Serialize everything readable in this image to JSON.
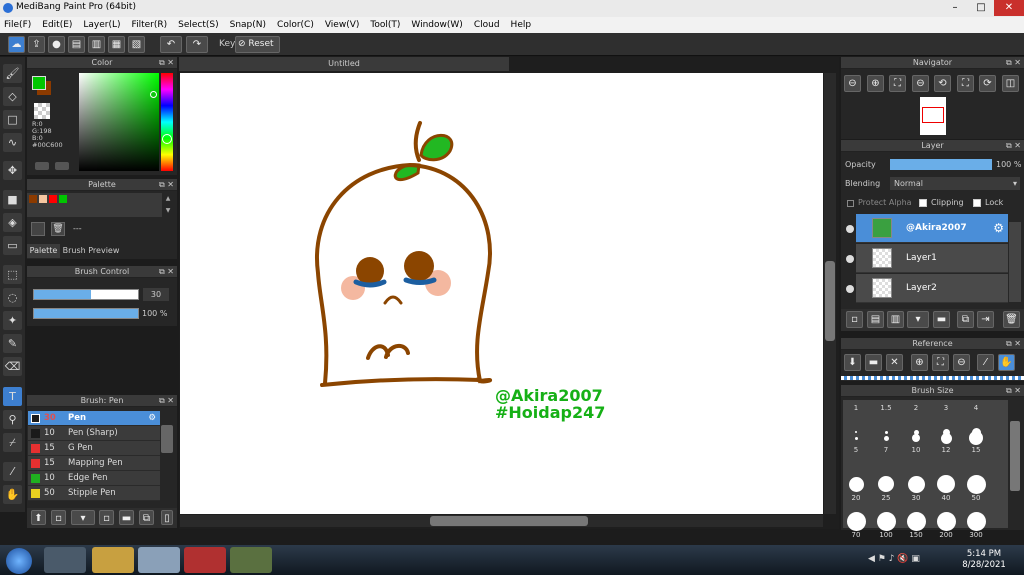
{
  "window": {
    "title": "MediBang Paint Pro (64bit)"
  },
  "menu": [
    "File(F)",
    "Edit(E)",
    "Layer(L)",
    "Filter(R)",
    "Select(S)",
    "Snap(N)",
    "Color(C)",
    "View(V)",
    "Tool(T)",
    "Window(W)",
    "Cloud",
    "Help"
  ],
  "toolbar": {
    "key_label": "Key",
    "reset_label": "Reset"
  },
  "color_panel": {
    "title": "Color",
    "r": "R:0",
    "g": "G:198",
    "b": "B:0",
    "hex": "#00C600",
    "fg": "#00c600",
    "bg": "#8b3a00"
  },
  "palette_panel": {
    "title": "Palette",
    "name": "---",
    "tab1": "Palette",
    "tab2": "Brush Preview",
    "colors": [
      "#8b3a00",
      "#f5c6a0",
      "#ff0000",
      "#00c600"
    ]
  },
  "brush_control": {
    "title": "Brush Control",
    "size": "30",
    "opacity": "100 %",
    "size_fraction": 0.55,
    "opacity_fraction": 1.0
  },
  "brush_panel": {
    "title": "Brush: Pen",
    "items": [
      {
        "size": "30",
        "name": "Pen",
        "color": "#1a1a1a"
      },
      {
        "size": "10",
        "name": "Pen (Sharp)",
        "color": "#1a1a1a"
      },
      {
        "size": "15",
        "name": "G Pen",
        "color": "#e53030"
      },
      {
        "size": "15",
        "name": "Mapping Pen",
        "color": "#e53030"
      },
      {
        "size": "10",
        "name": "Edge Pen",
        "color": "#20b020"
      },
      {
        "size": "50",
        "name": "Stipple Pen",
        "color": "#e8d020"
      }
    ]
  },
  "canvas": {
    "tab": "Untitled",
    "watermark1": "@Akira2007",
    "watermark2": "#Hoidap247"
  },
  "navigator": {
    "title": "Navigator"
  },
  "layer_panel": {
    "title": "Layer",
    "opacity_label": "Opacity",
    "opacity_value": "100 %",
    "blending_label": "Blending",
    "blending_value": "Normal",
    "protect_alpha": "Protect Alpha",
    "clipping": "Clipping",
    "lock": "Lock",
    "layers": [
      {
        "name": "@Akira2007"
      },
      {
        "name": "Layer1"
      },
      {
        "name": "Layer2"
      }
    ]
  },
  "reference": {
    "title": "Reference"
  },
  "brush_size": {
    "title": "Brush Size",
    "row1": [
      "1",
      "1.5",
      "2",
      "3",
      "4"
    ],
    "row2": [
      "5",
      "7",
      "10",
      "12",
      "15"
    ],
    "row3": [
      "20",
      "25",
      "30",
      "40",
      "50"
    ],
    "row4": [
      "70",
      "100",
      "150",
      "200",
      "300"
    ]
  },
  "taskbar": {
    "time": "5:14 PM",
    "date": "8/28/2021"
  }
}
